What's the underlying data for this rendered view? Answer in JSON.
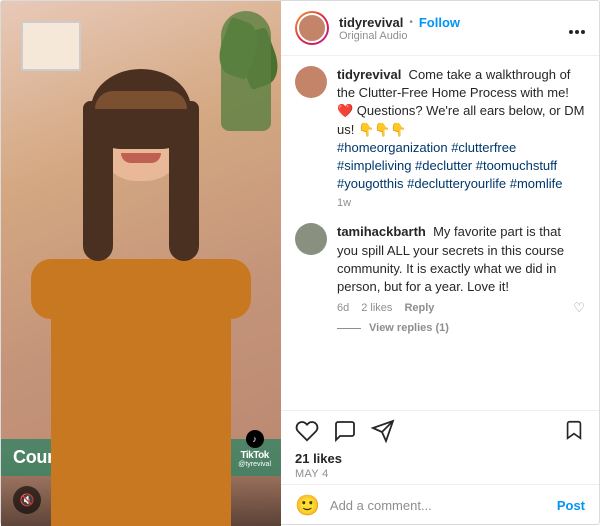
{
  "video": {
    "caption_text": "Course walkthrough!",
    "tiktok_label": "TikTok",
    "tiktok_username": "@tyrevival"
  },
  "post": {
    "username": "tidyrevival",
    "follow_label": "Follow",
    "audio_label": "Original Audio",
    "menu_label": "...",
    "comments": [
      {
        "id": "comment-1",
        "username": "tidyrevival",
        "text": "Come take a walkthrough of the Clutter-Free Home Process with me! ❤️ Questions? We're all ears below, or DM us! 👇👇👇",
        "hashtags": "#homeorganization #clutterfree #simpleliving #declutter #toomuchstuff #yougotthis #declutteryourlife #momlife",
        "time": "1w",
        "has_heart": false,
        "has_replies": false
      },
      {
        "id": "comment-2",
        "username": "tamihackbarth",
        "text": "My favorite part is that you spill ALL your secrets in this course community. It is exactly what we did in person, but for a year. Love it!",
        "time": "6d",
        "likes": "2 likes",
        "reply_label": "Reply",
        "has_heart": true,
        "has_replies": true,
        "replies_count": "View replies (1)"
      }
    ],
    "likes_count": "21 likes",
    "post_date": "May 4",
    "add_comment_placeholder": "Add a comment...",
    "post_btn_label": "Post"
  }
}
